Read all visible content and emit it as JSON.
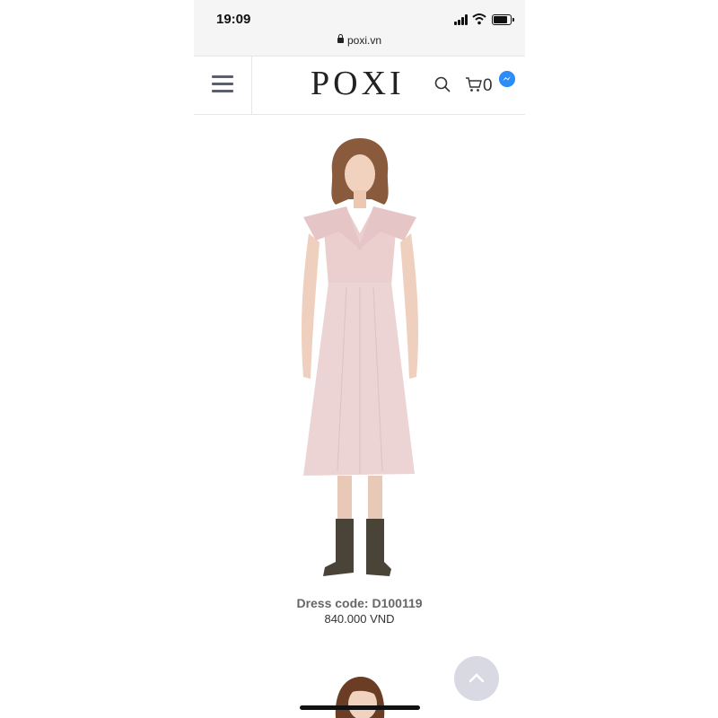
{
  "status_bar": {
    "time": "19:09"
  },
  "browser": {
    "url": "poxi.vn"
  },
  "header": {
    "logo": "POXI",
    "cart_count": "0"
  },
  "product": {
    "code": "Dress code: D100119",
    "price": "840.000 VND"
  },
  "icons": {
    "menu": "hamburger-icon",
    "search": "search-icon",
    "cart": "cart-icon",
    "messenger": "messenger-icon",
    "scroll_top": "chevron-up-icon"
  },
  "colors": {
    "dress": "#ebcfcf",
    "menu_icon": "#5a5f6b",
    "messenger": "#2e8cf6",
    "scroll_button": "#d9d9e3"
  }
}
